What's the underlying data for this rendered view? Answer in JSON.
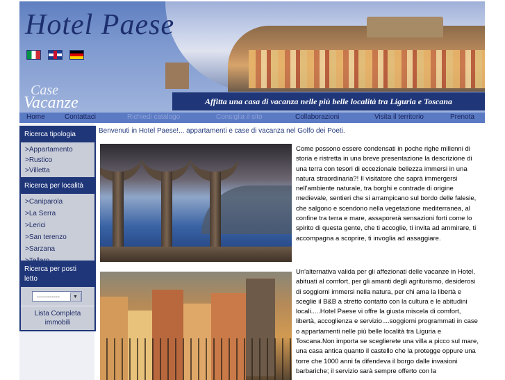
{
  "header": {
    "title": "Hotel Paese",
    "logo_line1": "Case",
    "logo_line2": "Vacanze",
    "tagline": "Affitta una casa di vacanza nelle più belle località tra Liguria e Toscana",
    "flags": [
      "flag-italy-icon",
      "flag-uk-icon",
      "flag-germany-icon"
    ]
  },
  "nav": {
    "items": [
      "Home",
      "Contattaci",
      "Richiedi catalogo",
      "Consiglia il sito",
      "Collaborazioni",
      "Visita il territorio",
      "Prenota"
    ]
  },
  "sidebar": {
    "tipologia": {
      "title": "Ricerca tipologia",
      "items": [
        ">Appartamento",
        ">Rustico",
        ">Villetta"
      ]
    },
    "localita": {
      "title": "Ricerca per località",
      "items": [
        ">Caniparola",
        ">La Serra",
        ">Lerici",
        ">San terenzo",
        ">Sarzana",
        ">Tellaro"
      ]
    },
    "posti": {
      "title": "Ricerca per posti letto",
      "select_value": "-----------"
    },
    "lista": "Lista Completa immobili"
  },
  "main": {
    "welcome": "Benvenuti in Hotel Paese!... appartamenti e case di vacanza nel Golfo dei Poeti.",
    "paragraph1": "Come possono essere condensati in poche righe millenni di storia e ristretta in una breve presentazione la descrizione di una terra con tesori di eccezionale bellezza immersi in una natura straordinaria?! Il visitatore che saprà immergersi nell'ambiente naturale, tra borghi e contrade di origine medievale, sentieri che si arrampicano sul bordo delle falesie, che salgono e scendono nella vegetazione mediterranea, al confine tra terra e mare, assaporerà sensazioni forti come lo spirito di questa gente, che ti accoglie, ti invita ad ammirare, ti accompagna a scoprire, ti invoglia ad assaggiare.",
    "paragraph2": "Un'alternativa valida per gli affezionati delle vacanze in Hotel, abituati al comfort, per gli amanti degli agriturismo, desiderosi di soggiorni immersi nella natura, per chi ama la libertà e sceglie il B&B a stretto contatto con la cultura e le abitudini locali.....Hotel Paese vi offre la giusta miscela di comfort, libertà, accoglienza e servizio....soggiorni programmati in case o appartamenti nelle più belle località tra Liguria e Toscana.Non importa se sceglierete una villa a picco sul mare, una casa antica quanto il castello che la protegge oppure una torre che 1000 anni fa difendeva il borgo dalle invasioni barbariche; il servizio sarà sempre offerto con la"
  }
}
